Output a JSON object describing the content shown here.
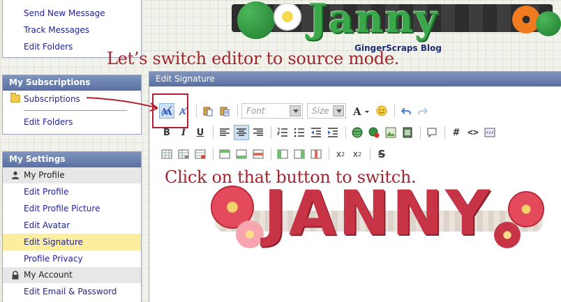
{
  "sidebar": {
    "messages": {
      "items": [
        {
          "label": "Send New Message"
        },
        {
          "label": "Track Messages"
        },
        {
          "label": "Edit Folders"
        }
      ]
    },
    "subscriptions": {
      "heading": "My Subscriptions",
      "items": [
        {
          "label": "Subscriptions",
          "icon": "folder-icon"
        },
        {
          "label": "Edit Folders"
        }
      ]
    },
    "settings": {
      "heading": "My Settings",
      "profile_group": "My Profile",
      "profile_items": [
        {
          "label": "Edit Profile"
        },
        {
          "label": "Edit Profile Picture"
        },
        {
          "label": "Edit Avatar"
        },
        {
          "label": "Edit Signature",
          "active": true
        },
        {
          "label": "Profile Privacy"
        }
      ],
      "account_group": "My Account",
      "account_items": [
        {
          "label": "Edit Email & Password"
        }
      ]
    }
  },
  "header": {
    "banner_text": "Janny",
    "blog_title": "GingerScraps Blog"
  },
  "instructions": {
    "top": "Let’s switch editor to source mode.",
    "bottom": "Click on that button to switch."
  },
  "editor": {
    "title": "Edit Signature",
    "font_placeholder": "Font",
    "size_placeholder": "Size",
    "signature_text": "JANNY"
  },
  "colors": {
    "accent": "#a0262e",
    "header_bar": "#6b80b0",
    "link": "#22229a",
    "active_item": "#fbee9e"
  }
}
